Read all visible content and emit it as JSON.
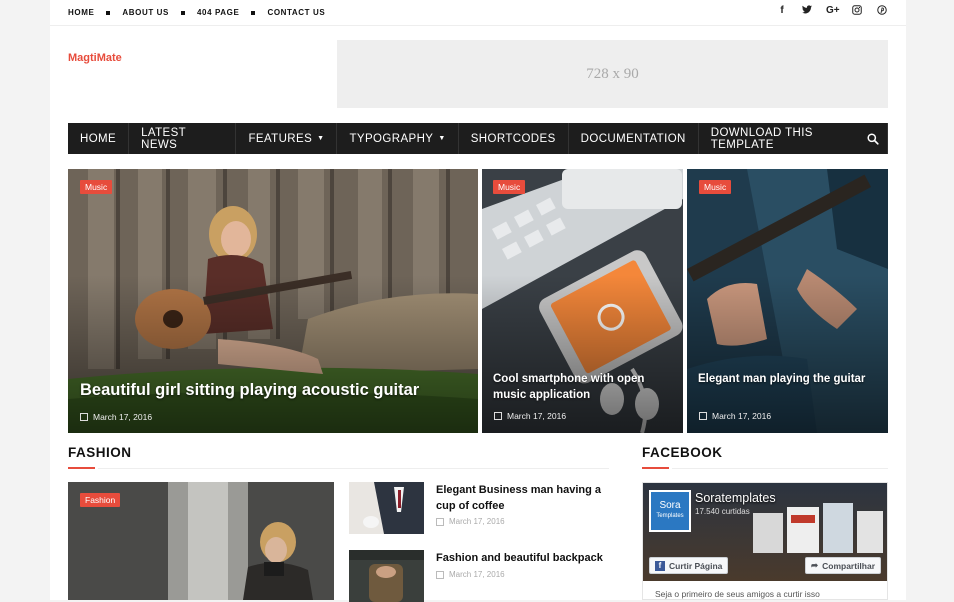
{
  "topbar": {
    "links": [
      "HOME",
      "ABOUT US",
      "404 PAGE",
      "CONTACT US"
    ],
    "social_icons": [
      {
        "name": "facebook-icon",
        "glyph": "f"
      },
      {
        "name": "twitter-icon",
        "glyph": "t"
      },
      {
        "name": "google-plus-icon",
        "glyph": "G+"
      },
      {
        "name": "instagram-icon",
        "glyph": "◎"
      },
      {
        "name": "pinterest-icon",
        "glyph": "℗"
      }
    ]
  },
  "header": {
    "logo": "MagtiMate",
    "ad_text": "728 x 90"
  },
  "nav": {
    "items": [
      "HOME",
      "LATEST NEWS",
      "FEATURES",
      "TYPOGRAPHY",
      "SHORTCODES",
      "DOCUMENTATION",
      "DOWNLOAD THIS TEMPLATE"
    ],
    "search_icon": "search-icon"
  },
  "featured": [
    {
      "label": "Music",
      "title": "Beautiful girl sitting playing acoustic guitar",
      "date": "March 17, 2016"
    },
    {
      "label": "Music",
      "title": "Cool smartphone with open music application",
      "date": "March 17, 2016"
    },
    {
      "label": "Music",
      "title": "Elegant man playing the guitar",
      "date": "March 17, 2016"
    }
  ],
  "fashion": {
    "heading": "FASHION",
    "big_label": "Fashion",
    "posts": [
      {
        "title": "Elegant Business man having a cup of coffee",
        "date": "March 17, 2016"
      },
      {
        "title": "Fashion and beautiful backpack",
        "date": "March 17, 2016"
      }
    ]
  },
  "facebook": {
    "heading": "FACEBOOK",
    "avatar_line1": "Sora",
    "avatar_line2": "Templates",
    "page_name": "Soratemplates",
    "likes": "17.540 curtidas",
    "like_button": "Curtir Página",
    "share_button": "Compartilhar",
    "footer": "Seja o primeiro de seus amigos a curtir isso"
  },
  "colors": {
    "accent": "#e74c3c",
    "nav_bg": "#1d1d1d"
  }
}
